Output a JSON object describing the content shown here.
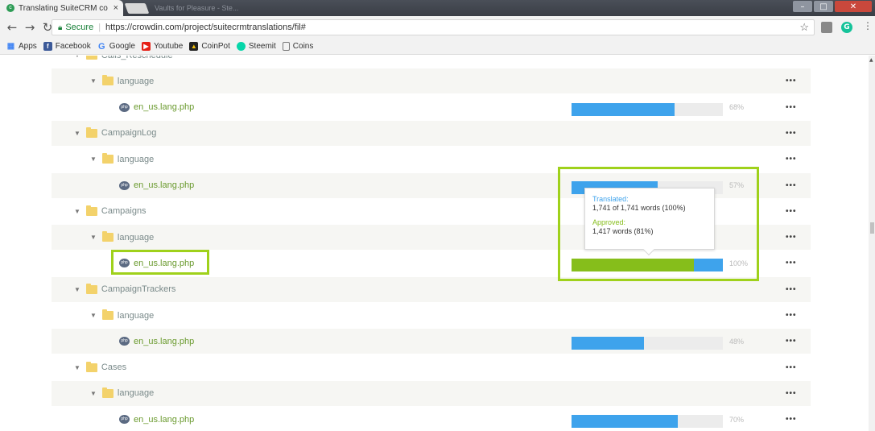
{
  "browser": {
    "tab_title": "Translating SuiteCRM co",
    "tab_close": "×",
    "background_tab": "Vaults for Pleasure - Ste...",
    "secure_label": "Secure",
    "url": "https://crowdin.com/project/suitecrmtranslations/fil#",
    "bookmarks": [
      "Apps",
      "Facebook",
      "Google",
      "Youtube",
      "CoinPot",
      "Steemit",
      "Coins"
    ]
  },
  "rows": [
    {
      "kind": "folder",
      "level": 0,
      "name": "Calls_Reschedule",
      "partial": true
    },
    {
      "kind": "folder",
      "level": 1,
      "name": "language"
    },
    {
      "kind": "file",
      "name": "en_us.lang.php",
      "translated": 0.68,
      "percent": "68%"
    },
    {
      "kind": "folder",
      "level": 0,
      "name": "CampaignLog"
    },
    {
      "kind": "folder",
      "level": 1,
      "name": "language"
    },
    {
      "kind": "file",
      "name": "en_us.lang.php",
      "translated": 0.57,
      "percent": "57%"
    },
    {
      "kind": "folder",
      "level": 0,
      "name": "Campaigns"
    },
    {
      "kind": "folder",
      "level": 1,
      "name": "language"
    },
    {
      "kind": "file",
      "name": "en_us.lang.php",
      "translated": 1.0,
      "approved": 0.81,
      "percent": "100%"
    },
    {
      "kind": "folder",
      "level": 0,
      "name": "CampaignTrackers"
    },
    {
      "kind": "folder",
      "level": 1,
      "name": "language"
    },
    {
      "kind": "file",
      "name": "en_us.lang.php",
      "translated": 0.48,
      "percent": "48%"
    },
    {
      "kind": "folder",
      "level": 0,
      "name": "Cases"
    },
    {
      "kind": "folder",
      "level": 1,
      "name": "language"
    },
    {
      "kind": "file",
      "name": "en_us.lang.php",
      "translated": 0.7,
      "percent": "70%"
    }
  ],
  "menu_dots": "•••",
  "tooltip": {
    "translated_label": "Translated:",
    "translated_value": "1,741 of 1,741 words (100%)",
    "approved_label": "Approved:",
    "approved_value": "1,417 words (81%)"
  },
  "colors": {
    "translated": "#3ea3ec",
    "approved": "#86be1b",
    "highlight": "#9fd11b"
  }
}
